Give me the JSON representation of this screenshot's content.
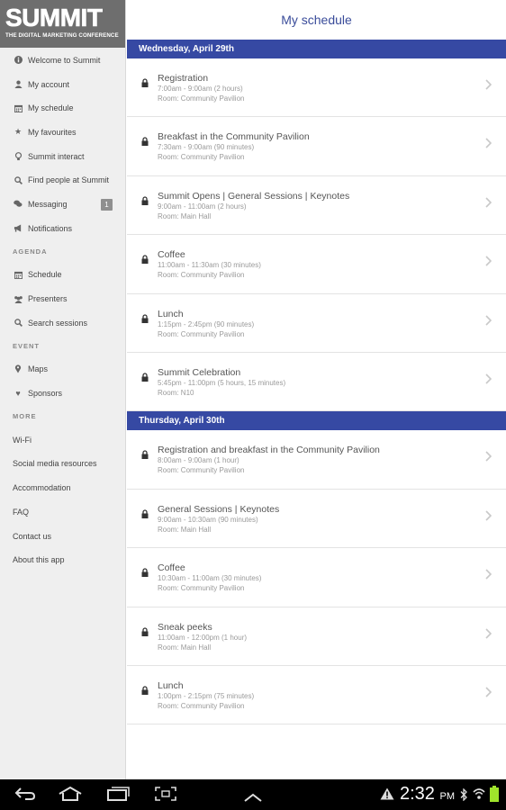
{
  "sidebar": {
    "logo": {
      "main": "SUMMIT",
      "sub": "THE DIGITAL MARKETING CONFERENCE"
    },
    "items": [
      {
        "label": "Welcome to Summit",
        "icon": "info-icon"
      },
      {
        "label": "My account",
        "icon": "user-icon"
      },
      {
        "label": "My schedule",
        "icon": "calendar-icon"
      },
      {
        "label": "My favourites",
        "icon": "star-icon"
      },
      {
        "label": "Summit interact",
        "icon": "bulb-icon"
      },
      {
        "label": "Find people at Summit",
        "icon": "search-icon"
      },
      {
        "label": "Messaging",
        "icon": "chat-icon",
        "badge": "1"
      },
      {
        "label": "Notifications",
        "icon": "megaphone-icon"
      }
    ],
    "agenda_head": "AGENDA",
    "agenda": [
      {
        "label": "Schedule",
        "icon": "calendar-icon"
      },
      {
        "label": "Presenters",
        "icon": "people-icon"
      },
      {
        "label": "Search sessions",
        "icon": "search-icon"
      }
    ],
    "event_head": "EVENT",
    "event": [
      {
        "label": "Maps",
        "icon": "pin-icon"
      },
      {
        "label": "Sponsors",
        "icon": "heart-icon"
      }
    ],
    "more_head": "MORE",
    "more": [
      {
        "label": "Wi-Fi"
      },
      {
        "label": "Social media resources"
      },
      {
        "label": "Accommodation"
      },
      {
        "label": "FAQ"
      },
      {
        "label": "Contact us"
      },
      {
        "label": "About this app"
      }
    ]
  },
  "main": {
    "title": "My schedule",
    "days": [
      {
        "label": "Wednesday, April 29th",
        "sessions": [
          {
            "title": "Registration",
            "time": "7:00am - 9:00am  (2 hours)",
            "room": "Room: Community Pavilion"
          },
          {
            "title": "Breakfast in the Community Pavilion",
            "time": "7:30am - 9:00am  (90 minutes)",
            "room": "Room: Community Pavilion"
          },
          {
            "title": "Summit Opens | General Sessions | Keynotes",
            "time": "9:00am - 11:00am  (2 hours)",
            "room": "Room: Main Hall"
          },
          {
            "title": "Coffee",
            "time": "11:00am - 11:30am  (30 minutes)",
            "room": "Room: Community Pavilion"
          },
          {
            "title": "Lunch",
            "time": "1:15pm - 2:45pm  (90 minutes)",
            "room": "Room: Community Pavilion"
          },
          {
            "title": "Summit Celebration",
            "time": "5:45pm - 11:00pm  (5 hours, 15 minutes)",
            "room": "Room: N10"
          }
        ]
      },
      {
        "label": "Thursday, April 30th",
        "sessions": [
          {
            "title": "Registration and breakfast in the Community Pavilion",
            "time": "8:00am - 9:00am  (1 hour)",
            "room": "Room: Community Pavilion"
          },
          {
            "title": "General Sessions | Keynotes",
            "time": "9:00am - 10:30am  (90 minutes)",
            "room": "Room: Main Hall"
          },
          {
            "title": "Coffee",
            "time": "10:30am - 11:00am  (30 minutes)",
            "room": "Room: Community Pavilion"
          },
          {
            "title": "Sneak peeks",
            "time": "11:00am - 12:00pm  (1 hour)",
            "room": "Room: Main Hall"
          },
          {
            "title": "Lunch",
            "time": "1:00pm - 2:15pm  (75 minutes)",
            "room": "Room: Community Pavilion"
          }
        ]
      }
    ]
  },
  "status": {
    "time": "2:32",
    "ampm": "PM"
  },
  "colors": {
    "accent": "#3649a3",
    "title": "#3a4c9a",
    "sidebar_bg": "#efefef",
    "logo_bg": "#6e6e6e",
    "battery": "#9fe32b"
  }
}
